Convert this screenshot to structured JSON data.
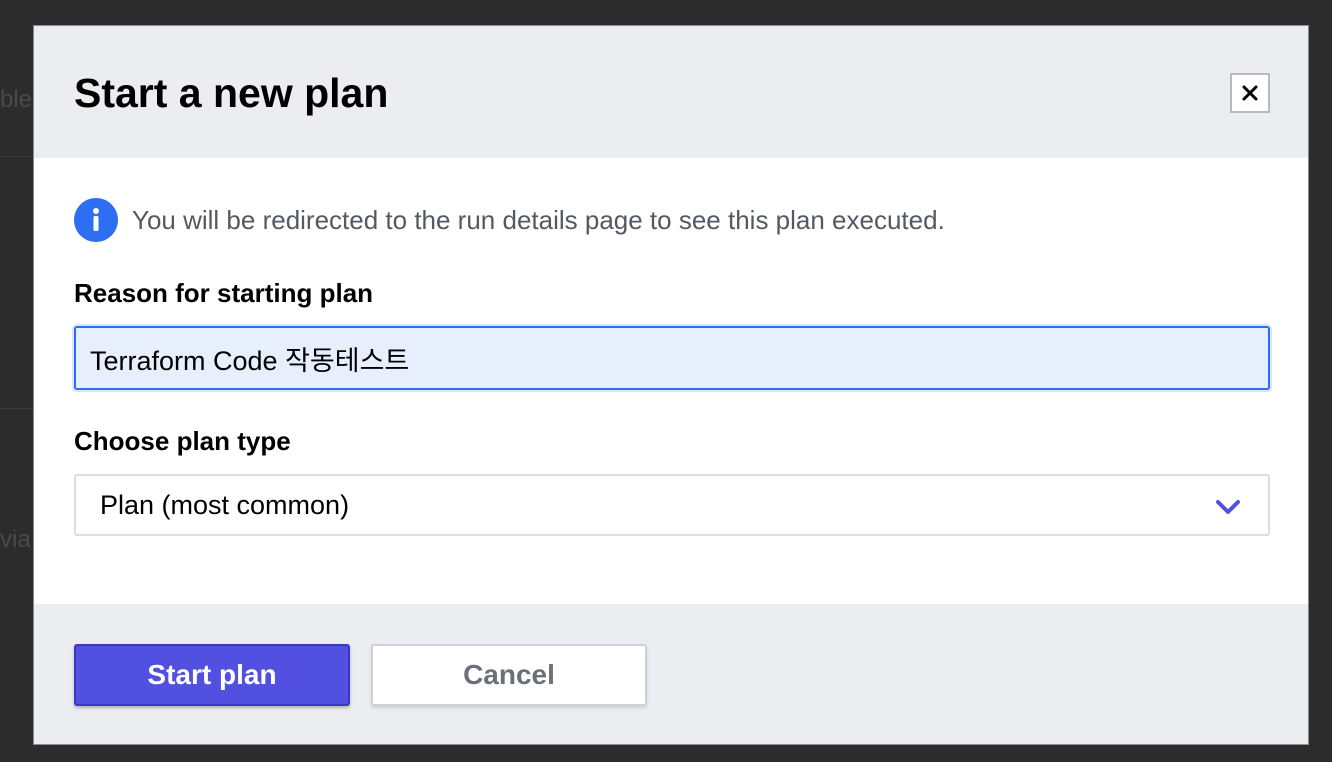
{
  "modal": {
    "title": "Start a new plan",
    "close_icon": "close-icon"
  },
  "info": {
    "icon": "info-icon",
    "message": "You will be redirected to the run details page to see this plan executed."
  },
  "reason": {
    "label": "Reason for starting plan",
    "value": "Terraform Code 작동테스트"
  },
  "plan_type": {
    "label": "Choose plan type",
    "selected": "Plan (most common)",
    "icon": "chevron-down-icon"
  },
  "footer": {
    "start_label": "Start plan",
    "cancel_label": "Cancel"
  },
  "background": {
    "fragment_1": "ble",
    "fragment_2": "via"
  },
  "colors": {
    "primary": "#5150e0",
    "info_blue": "#2d6ef3",
    "chevron": "#5150e0"
  }
}
